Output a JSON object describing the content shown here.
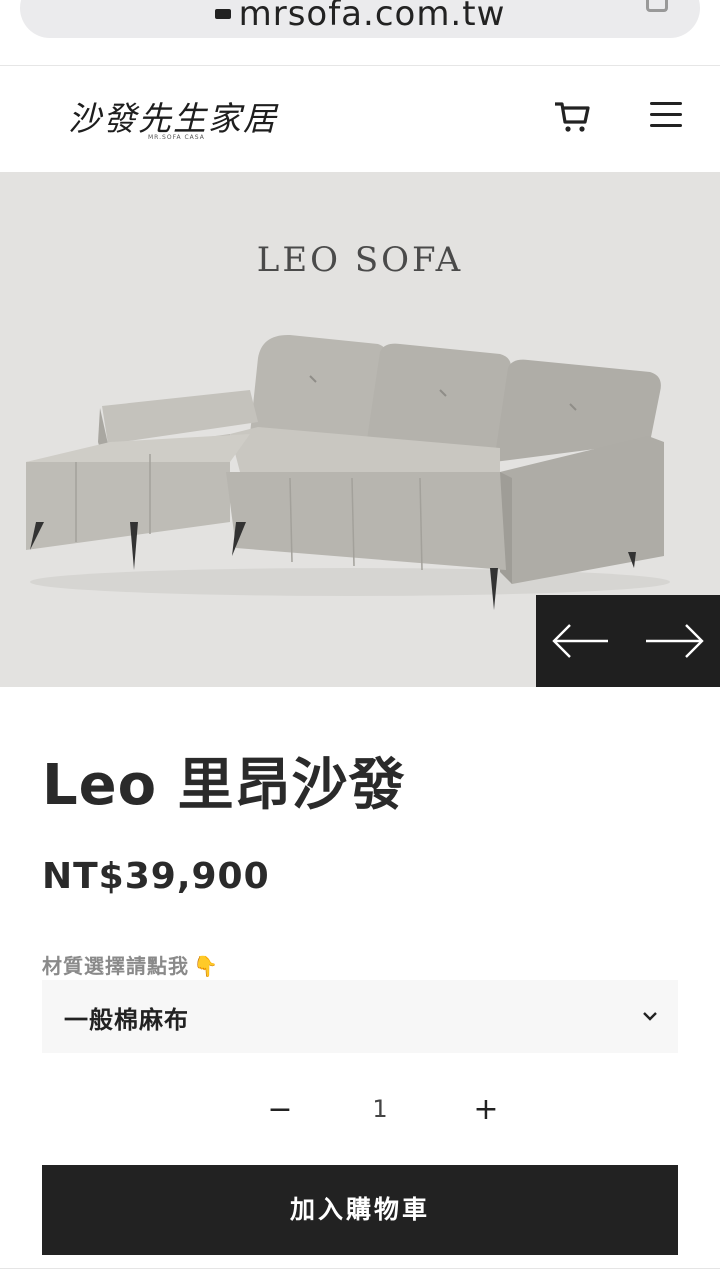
{
  "browser": {
    "url": "mrsofa.com.tw"
  },
  "header": {
    "logo_text": "沙發先生家居",
    "logo_subtext": "MR.SOFA CASA",
    "cart_icon": "cart-icon",
    "menu_icon": "hamburger-menu-icon"
  },
  "hero": {
    "image_caption": "LEO SOFA",
    "prev_icon": "arrow-left-icon",
    "next_icon": "arrow-right-icon"
  },
  "product": {
    "title": "Leo 里昂沙發",
    "price": "NT$39,900",
    "material_label": "材質選擇請點我",
    "material_emoji": "👇",
    "material_selected": "一般棉麻布",
    "quantity": "1",
    "qty_minus": "−",
    "qty_plus": "+",
    "add_to_cart": "加入購物車"
  },
  "colors": {
    "accent_dark": "#222222",
    "hero_bg": "#e3e2e0",
    "select_bg": "#f7f7f7"
  }
}
